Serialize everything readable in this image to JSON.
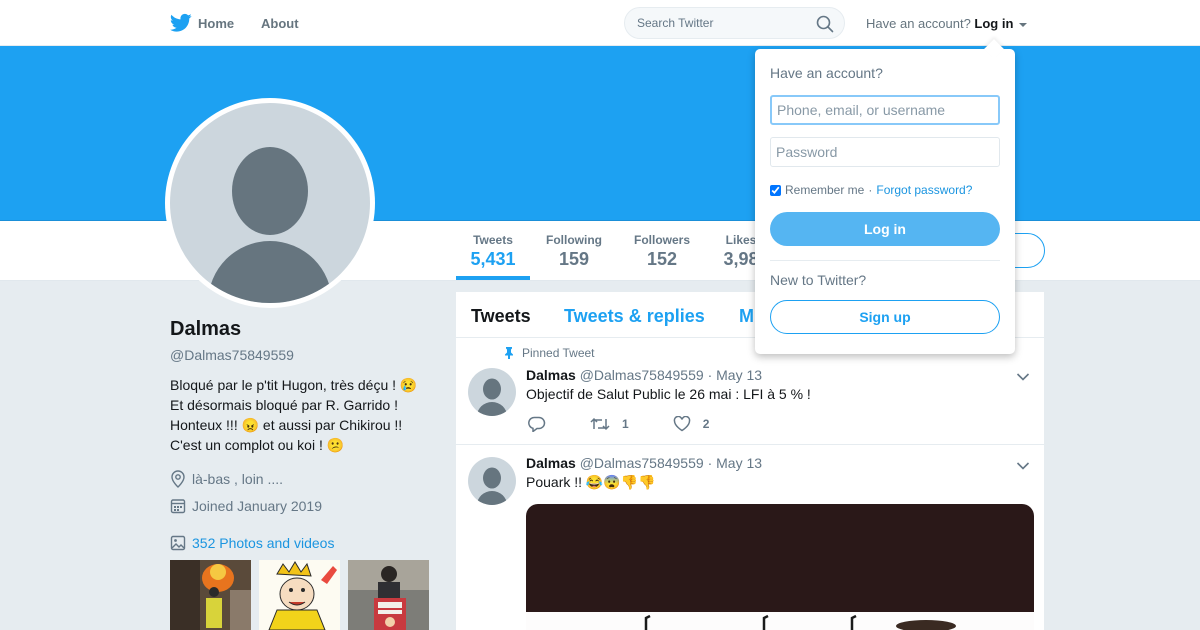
{
  "nav": {
    "home_label": "Home",
    "about_label": "About",
    "search_placeholder": "Search Twitter",
    "have_account_label": "Have an account?",
    "login_label": "Log in"
  },
  "profile": {
    "name": "Dalmas",
    "handle": "@Dalmas75849559",
    "bio_lines": [
      "Bloqué par le p'tit Hugon, très déçu ! 😢",
      "Et désormais bloqué par R. Garrido !",
      "Honteux !!! 😠 et aussi par Chikirou !!",
      "C'est un complot ou koi ! 😕"
    ],
    "location": "là-bas , loin ....",
    "joined": "Joined January 2019",
    "photos_label": "352 Photos and videos"
  },
  "stats": [
    {
      "label": "Tweets",
      "value": "5,431"
    },
    {
      "label": "Following",
      "value": "159"
    },
    {
      "label": "Followers",
      "value": "152"
    },
    {
      "label": "Likes",
      "value": "3,98"
    }
  ],
  "timeline": {
    "tabs": [
      "Tweets",
      "Tweets & replies",
      "M"
    ],
    "tweets": [
      {
        "pinned_label": "Pinned Tweet",
        "name": "Dalmas",
        "handle": "@Dalmas75849559",
        "date": "· May 13",
        "text": "Objectif de Salut Public le 26 mai  :  LFI à 5  % !",
        "retweets": "1",
        "likes": "2"
      },
      {
        "name": "Dalmas",
        "handle": "@Dalmas75849559",
        "date": "· May 13",
        "text": "Pouark !! 😂😨👎👎"
      }
    ]
  },
  "login_dropdown": {
    "title": "Have an account?",
    "username_placeholder": "Phone, email, or username",
    "password_placeholder": "Password",
    "remember_label": "Remember me",
    "separator": "·",
    "forgot_label": "Forgot password?",
    "login_button": "Log in",
    "new_label": "New to Twitter?",
    "signup_button": "Sign up"
  },
  "colors": {
    "brand": "#1da1f2",
    "banner": "#1da1f2",
    "link": "#1b95e0",
    "login_button": "#55b5f2"
  },
  "icons": [
    "twitter-bird-icon",
    "search-icon",
    "pin-icon",
    "location-icon",
    "calendar-icon",
    "photo-icon",
    "reply-icon",
    "retweet-icon",
    "like-icon",
    "chevron-down-icon"
  ]
}
